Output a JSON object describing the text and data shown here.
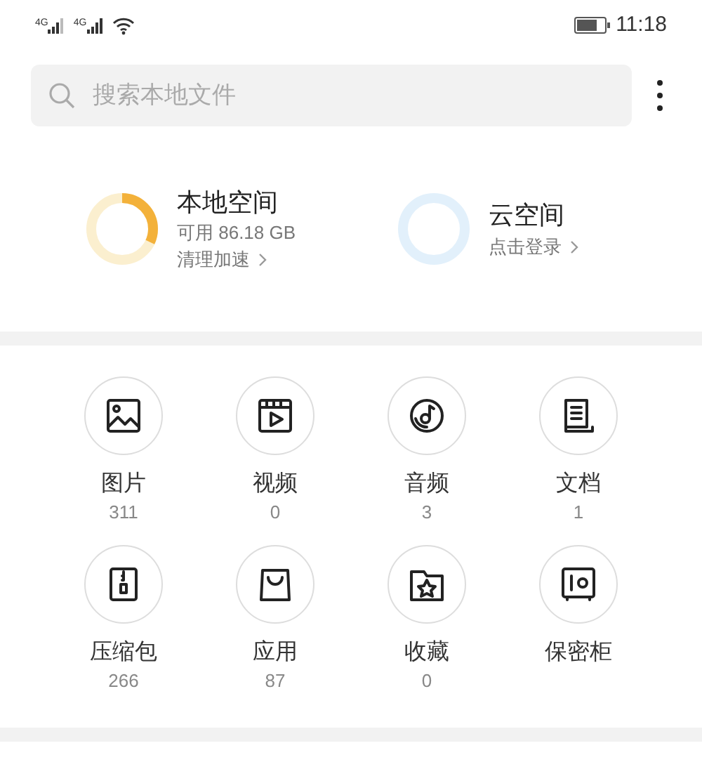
{
  "status_bar": {
    "network_1": "4G",
    "network_2": "4G",
    "time": "11:18"
  },
  "search": {
    "placeholder": "搜索本地文件"
  },
  "storage": [
    {
      "kind": "local",
      "title": "本地空间",
      "detail": "可用 86.18 GB",
      "action": "清理加速",
      "level": 0.32
    },
    {
      "kind": "cloud",
      "title": "云空间",
      "action": "点击登录"
    }
  ],
  "categories": [
    {
      "kind": "image",
      "label": "图片",
      "count": "311"
    },
    {
      "kind": "video",
      "label": "视频",
      "count": "0"
    },
    {
      "kind": "audio",
      "label": "音频",
      "count": "3"
    },
    {
      "kind": "document",
      "label": "文档",
      "count": "1"
    },
    {
      "kind": "archive",
      "label": "压缩包",
      "count": "266"
    },
    {
      "kind": "app",
      "label": "应用",
      "count": "87"
    },
    {
      "kind": "favorite",
      "label": "收藏",
      "count": "0"
    },
    {
      "kind": "safe",
      "label": "保密柜"
    }
  ]
}
